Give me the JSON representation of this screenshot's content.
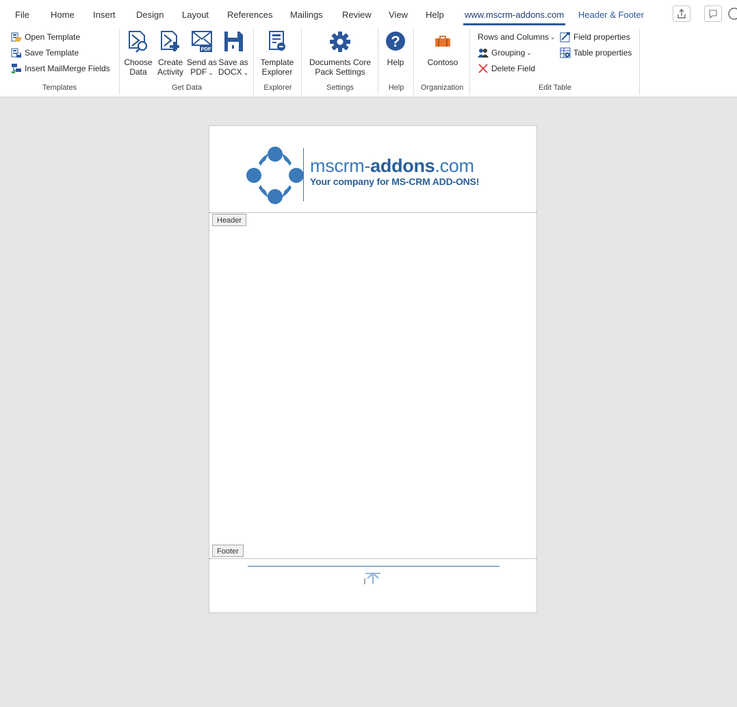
{
  "tabs": [
    {
      "label": "File"
    },
    {
      "label": "Home"
    },
    {
      "label": "Insert"
    },
    {
      "label": "Design"
    },
    {
      "label": "Layout"
    },
    {
      "label": "References"
    },
    {
      "label": "Mailings"
    },
    {
      "label": "Review"
    },
    {
      "label": "View"
    },
    {
      "label": "Help"
    },
    {
      "label": "www.mscrm-addons.com"
    },
    {
      "label": "Header & Footer"
    }
  ],
  "ribbon": {
    "templates": {
      "open": "Open Template",
      "save": "Save Template",
      "insert_fields": "Insert MailMerge Fields",
      "group": "Templates"
    },
    "get_data": {
      "choose": [
        "Choose",
        "Data"
      ],
      "create": [
        "Create",
        "Activity"
      ],
      "send_pdf": [
        "Send as",
        "PDF"
      ],
      "save_docx": [
        "Save as",
        "DOCX"
      ],
      "group": "Get Data"
    },
    "explorer": {
      "button": [
        "Template",
        "Explorer"
      ],
      "group": "Explorer"
    },
    "settings": {
      "button": [
        "Documents Core",
        "Pack Settings"
      ],
      "group": "Settings"
    },
    "help": {
      "button": "Help",
      "group": "Help"
    },
    "organization": {
      "button": "Contoso",
      "group": "Organization"
    },
    "edit_table": {
      "rows_columns": "Rows and Columns",
      "grouping": "Grouping",
      "delete_field": "Delete Field",
      "field_properties": "Field properties",
      "table_properties": "Table properties",
      "group": "Edit Table"
    }
  },
  "document": {
    "logo": {
      "main_prefix": "mscrm-",
      "main_bold": "addons",
      "main_suffix": ".com",
      "tagline": "Your company for MS-CRM ADD-ONS!"
    },
    "header_tag": "Header",
    "footer_tag": "Footer"
  },
  "colors": {
    "accent": "#2b579a",
    "logo_blue": "#3b79b8",
    "workspace": "#e6e6e6"
  }
}
